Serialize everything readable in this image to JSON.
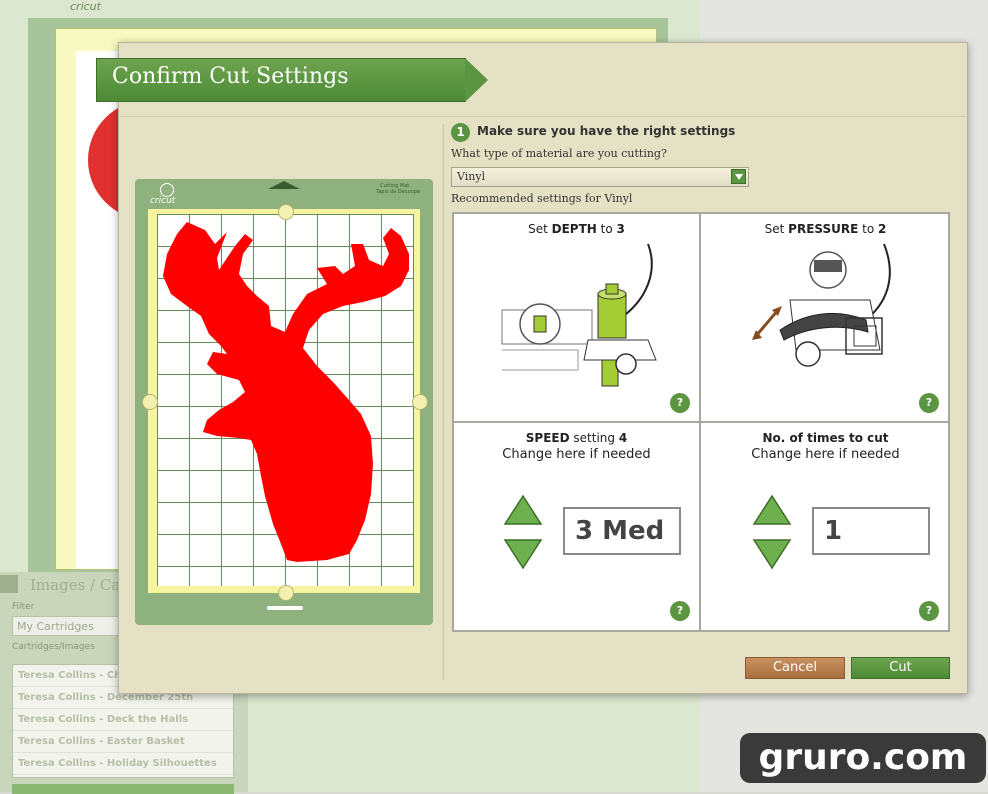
{
  "background": {
    "logo": "cricut",
    "panel_title": "Images / Ca",
    "filter_label": "Filter",
    "filter_value": "My Cartridges",
    "cartridges_label": "Cartridges/Images",
    "cartridges": [
      "Teresa Collins - Ch",
      "Teresa Collins - December 25th",
      "Teresa Collins - Deck the Halls",
      "Teresa Collins - Easter Basket",
      "Teresa Collins - Holiday Silhouettes"
    ]
  },
  "dialog": {
    "title": "Confirm Cut Settings",
    "mat": {
      "brand": "cricut",
      "label_line1": "Cutting Mat",
      "label_line2": "Tapis de Découpe"
    },
    "step": {
      "number": "1",
      "label": "Make sure you have the right settings"
    },
    "material_question": "What type of material are you cutting?",
    "material_selected": "Vinyl",
    "recommended_label": "Recommended settings for Vinyl",
    "depth": {
      "prefix": "Set",
      "label": "DEPTH",
      "to": "to",
      "value": "3"
    },
    "pressure": {
      "prefix": "Set",
      "label": "PRESSURE",
      "to": "to",
      "value": "2"
    },
    "speed": {
      "label": "SPEED",
      "suffix": "setting",
      "value": "4",
      "hint": "Change here if needed",
      "current": "3 Med"
    },
    "times": {
      "label": "No. of times to cut",
      "hint": "Change here if needed",
      "current": "1"
    },
    "help_symbol": "?",
    "cancel_label": "Cancel",
    "cut_label": "Cut"
  },
  "watermark": "gruro.com",
  "colors": {
    "accent_green": "#5b9541",
    "cancel_brown": "#a8703f",
    "deer_red": "#ff0000"
  }
}
